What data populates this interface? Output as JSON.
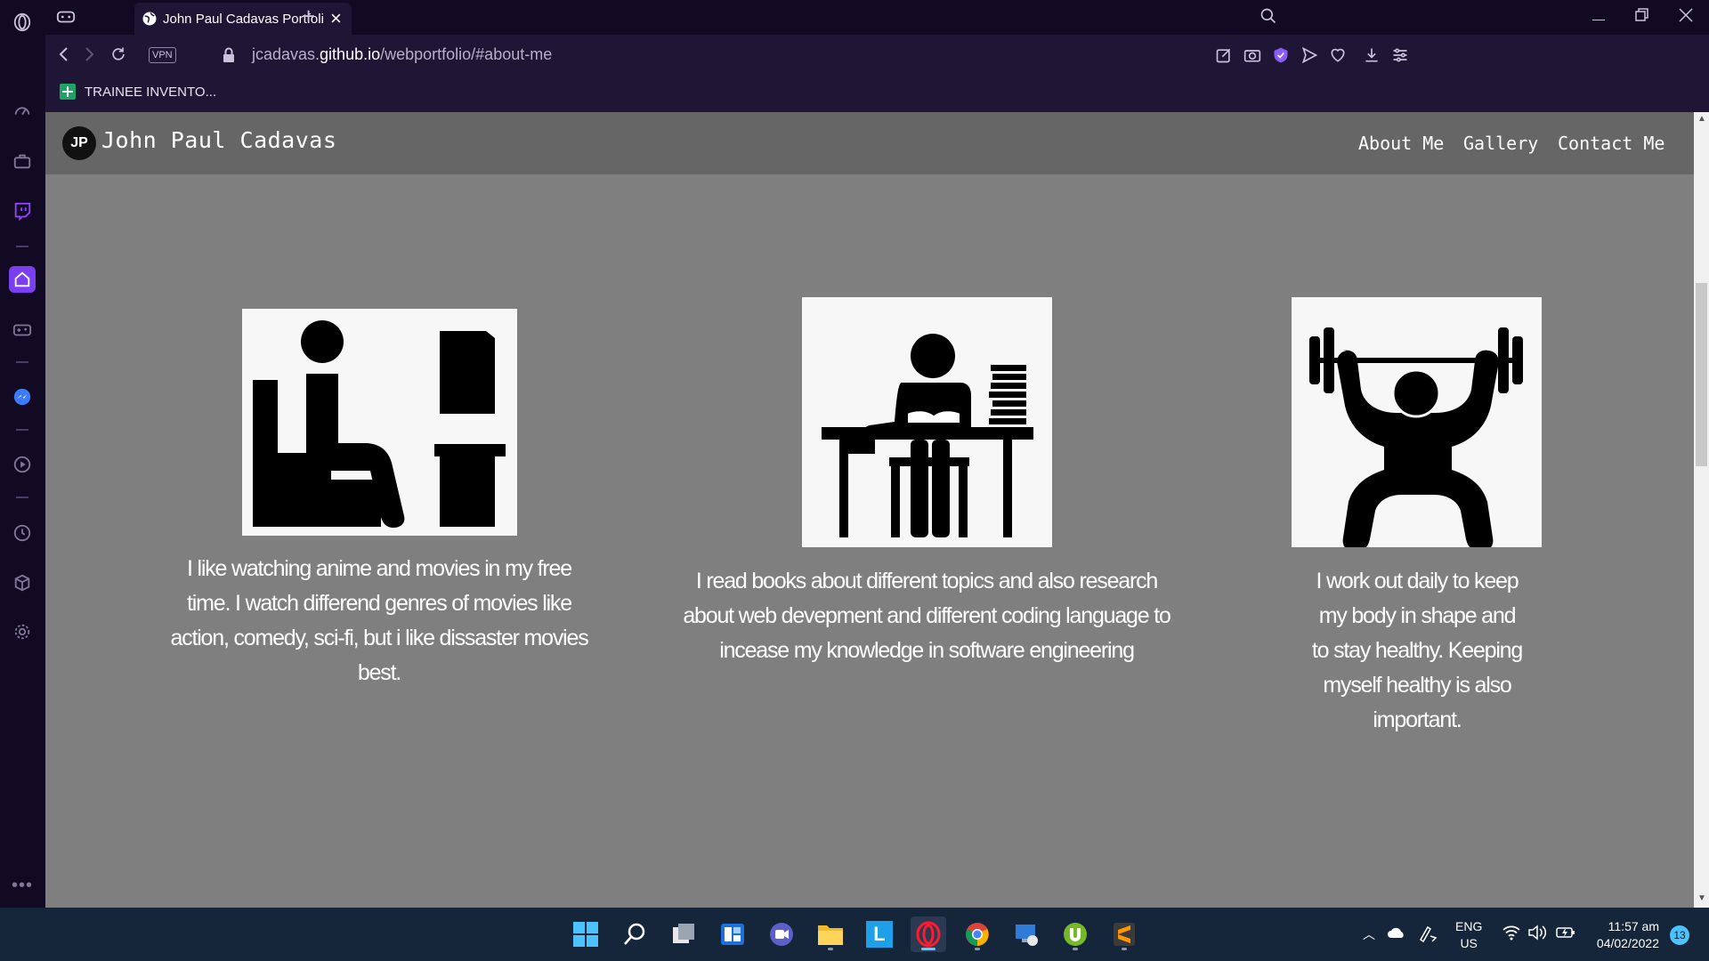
{
  "browser": {
    "tab_title": "John Paul Cadavas Portfolio",
    "url_prefix": "jcadavas.",
    "url_domain": "github.io",
    "url_path": "/webportfolio/#about-me",
    "vpn_label": "VPN",
    "bookmark_label": "TRAINEE INVENTO..."
  },
  "site": {
    "logo_text": "JP",
    "brand": "John Paul Cadavas",
    "nav": [
      "About Me",
      "Gallery",
      "Contact Me"
    ]
  },
  "cards": [
    {
      "icon": "watching-tv-icon",
      "text": "I like watching anime and movies in my free time. I watch differend genres of movies like action, comedy, sci-fi, but i like dissaster movies best."
    },
    {
      "icon": "reading-at-desk-icon",
      "text": "I read books about different topics and also research about web devepment and different coding language to incease my knowledge in software engineering"
    },
    {
      "icon": "weightlifting-icon",
      "text": "I work out daily to keep my body in shape and to stay healthy. Keeping myself healthy is also important."
    }
  ],
  "taskbar": {
    "language": "ENG",
    "region": "US",
    "time": "11:57 am",
    "date": "04/02/2022",
    "notification_count": "13",
    "apps": [
      "start",
      "search",
      "task-view",
      "widgets",
      "teams-chat",
      "file-explorer",
      "l-app",
      "opera",
      "chrome",
      "remote-desktop",
      "utorrent",
      "sublime-text"
    ]
  }
}
